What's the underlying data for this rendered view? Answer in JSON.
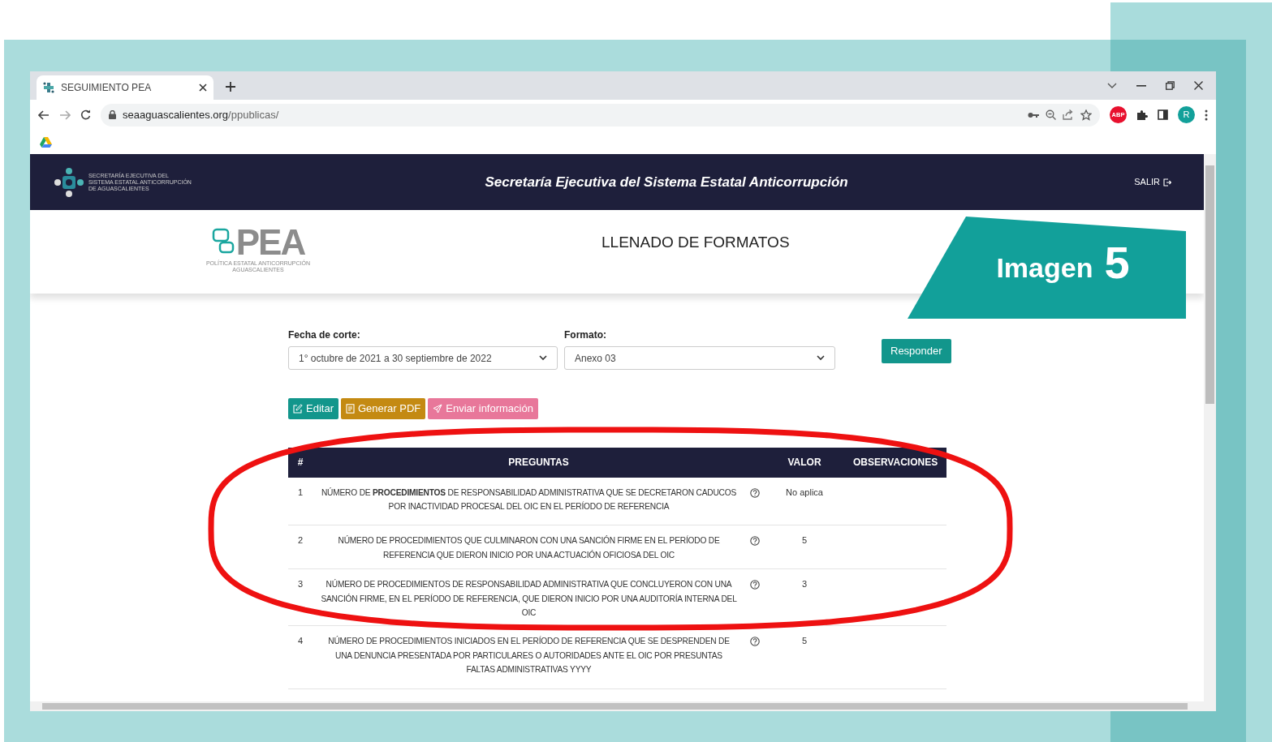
{
  "browser": {
    "tab": {
      "title": "SEGUIMIENTO PEA"
    },
    "url": {
      "host": "seaaguascalientes.org",
      "path": "/ppublicas/"
    },
    "adblock": "ABP",
    "avatar": "R"
  },
  "navbar": {
    "logo_lines": [
      "SECRETARÍA EJECUTIVA DEL",
      "SISTEMA ESTATAL ANTICORRUPCIÓN",
      "DE AGUASCALIENTES"
    ],
    "title": "Secretaría Ejecutiva del Sistema Estatal Anticorrupción",
    "logout": "SALIR"
  },
  "header": {
    "logo": {
      "text": "PEA",
      "subtitle_lines": [
        "POLÍTICA ESTATAL ANTICORRUPCIÓN",
        "AGUASCALIENTES"
      ]
    },
    "title": "LLENADO DE FORMATOS"
  },
  "overlay_label": {
    "text": "Imagen",
    "number": "5"
  },
  "filters": [
    {
      "label": "Fecha de corte:",
      "value": "1° octubre de 2021 a 30 septiembre de 2022"
    },
    {
      "label": "Formato:",
      "value": "Anexo 03"
    }
  ],
  "respond_button": "Responder",
  "actions": [
    {
      "kind": "edit",
      "label": "Editar"
    },
    {
      "kind": "pdf",
      "label": "Generar PDF"
    },
    {
      "kind": "send",
      "label": "Enviar información"
    }
  ],
  "table": {
    "columns": [
      "#",
      "PREGUNTAS",
      "VALOR",
      "OBSERVACIONES"
    ],
    "rows": [
      {
        "number": "1",
        "question": "NÚMERO DE **PROCEDIMIENTOS** DE RESPONSABILIDAD ADMINISTRATIVA QUE SE DECRETARON CADUCOS POR INACTIVIDAD PROCESAL DEL OIC EN EL PERÍODO DE REFERENCIA",
        "value": "No aplica"
      },
      {
        "number": "2",
        "question": "NÚMERO DE PROCEDIMIENTOS QUE CULMINARON CON UNA SANCIÓN FIRME EN EL PERÍODO DE REFERENCIA QUE DIERON INICIO POR UNA ACTUACIÓN OFICIOSA DEL OIC",
        "value": "5"
      },
      {
        "number": "3",
        "question": "NÚMERO DE PROCEDIMIENTOS DE RESPONSABILIDAD ADMINISTRATIVA QUE CONCLUYERON CON UNA SANCIÓN FIRME, EN EL PERÍODO DE REFERENCIA, QUE DIERON INICIO POR UNA AUDITORÍA INTERNA DEL OIC",
        "value": "3"
      },
      {
        "number": "4",
        "question": "NÚMERO DE PROCEDIMIENTOS INICIADOS EN EL PERÍODO DE REFERENCIA QUE SE DESPRENDEN DE UNA DENUNCIA PRESENTADA POR PARTICULARES O AUTORIDADES ANTE EL OIC POR PRESUNTAS FALTAS ADMINISTRATIVAS YYYY",
        "value": "5"
      }
    ]
  },
  "annotation": {
    "kind": "ellipse",
    "color": "#ee1111"
  }
}
